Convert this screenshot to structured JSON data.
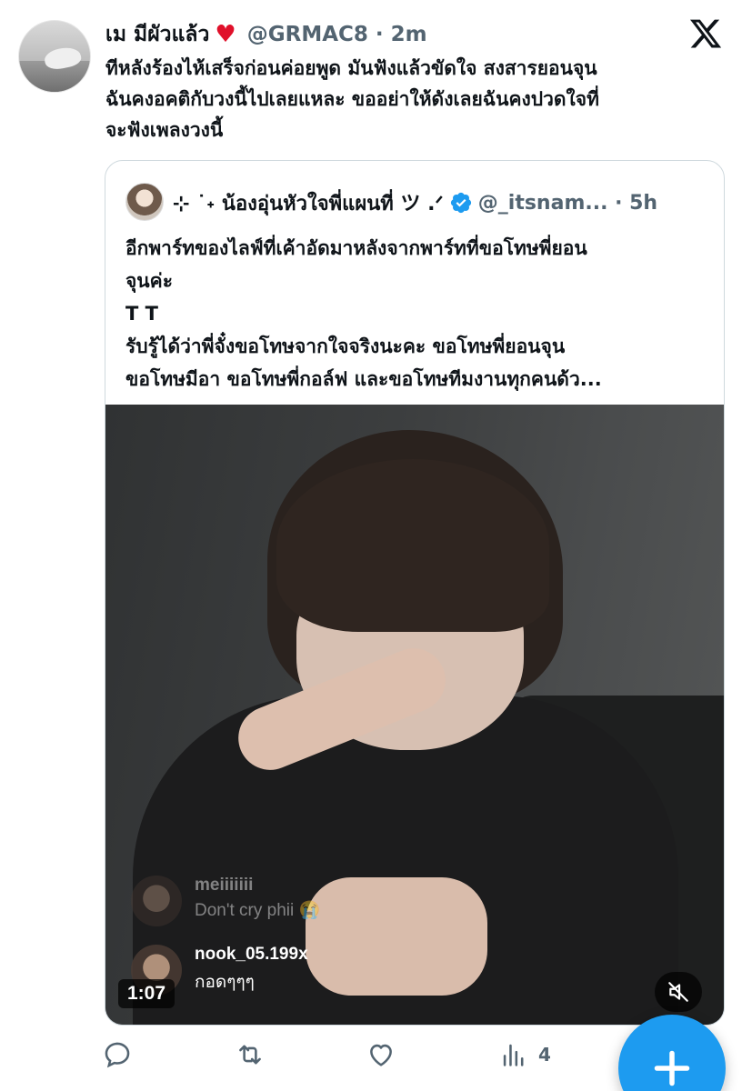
{
  "tweet": {
    "display_name": "เม มีผัวแล้ว",
    "name_emoji": "♥",
    "handle": "@GRMAC8 · 2m",
    "text": "ทีหลังร้องไห้เสร็จก่อนค่อยพูด มันฟังแล้วขัดใจ สงสารยอนจุน\nฉันคงอคติกับวงนี้ไปเลยแหละ ขออย่าให้ดังเลยฉันคงปวดใจที่\nจะฟังเพลงวงนี้"
  },
  "quoted": {
    "display_name": "⊹ ˙˖ น้องอุ่นหัวใจพี่แผนที่ ツ .ᐟ",
    "handle": "@_itsnam... · 5h",
    "text": "อีกพาร์ทของไลฟ์ที่เค้าอัดมาหลังจากพาร์ทที่ขอโทษพี่ยอน\nจุนค่ะ\nT T\nรับรู้ได้ว่าพี่จั๋งขอโทษจากใจจริงนะคะ ขอโทษพี่ยอนจุน\nขอโทษมีอา ขอโทษพี่กอล์ฟ และขอโทษทีมงานทุกคนด้ว...",
    "media": {
      "duration": "1:07",
      "comments": [
        {
          "user": "meiiiiiii",
          "message": "Don't cry phii 😭"
        },
        {
          "user": "nook_05.199x",
          "message": "กอดๆๆๆ"
        }
      ]
    }
  },
  "actions": {
    "reply": "",
    "retweet": "",
    "like": "",
    "views": "4"
  },
  "colors": {
    "accent": "#1d9bf0",
    "secondary_text": "#536471",
    "heart": "#e0102a"
  },
  "icons": [
    "x-logo-icon",
    "verified-badge-icon",
    "mute-icon",
    "reply-icon",
    "retweet-icon",
    "like-icon",
    "views-icon",
    "plus-icon"
  ]
}
